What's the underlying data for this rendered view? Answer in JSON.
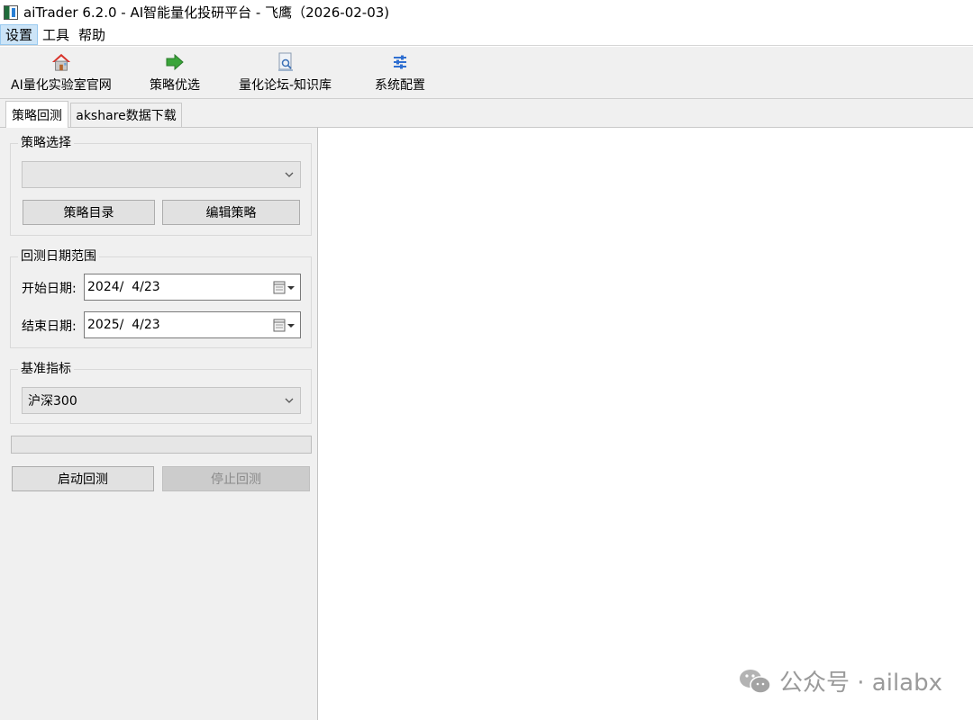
{
  "window": {
    "title": "aiTrader 6.2.0 - AI智能量化投研平台 - 飞鹰（2026-02-03)"
  },
  "menubar": {
    "items": [
      {
        "label": "设置",
        "active": true
      },
      {
        "label": "工具",
        "active": false
      },
      {
        "label": "帮助",
        "active": false
      }
    ]
  },
  "toolbar": {
    "items": [
      {
        "label": "AI量化实验室官网",
        "icon": "home-icon"
      },
      {
        "label": "策略优选",
        "icon": "green-arrow-icon"
      },
      {
        "label": "量化论坛-知识库",
        "icon": "document-search-icon"
      },
      {
        "label": "系统配置",
        "icon": "sliders-icon"
      }
    ]
  },
  "tabs": [
    {
      "label": "策略回测",
      "active": true
    },
    {
      "label": "akshare数据下载",
      "active": false
    }
  ],
  "strategy_group": {
    "title": "策略选择",
    "combo_value": "",
    "catalog_button": "策略目录",
    "edit_button": "编辑策略"
  },
  "date_group": {
    "title": "回测日期范围",
    "start_label": "开始日期:",
    "start_value": "2024/  4/23",
    "end_label": "结束日期:",
    "end_value": "2025/  4/23"
  },
  "benchmark_group": {
    "title": "基准指标",
    "combo_value": "沪深300"
  },
  "progress": {
    "value": 0
  },
  "actions": {
    "start_button": "启动回测",
    "stop_button": "停止回测"
  },
  "watermark": {
    "text": "公众号 · ailabx"
  },
  "colors": {
    "menu_active_bg": "#cce4f7",
    "panel_bg": "#f0f0f0",
    "button_bg": "#e1e1e1",
    "disabled_button_bg": "#cccccc"
  }
}
